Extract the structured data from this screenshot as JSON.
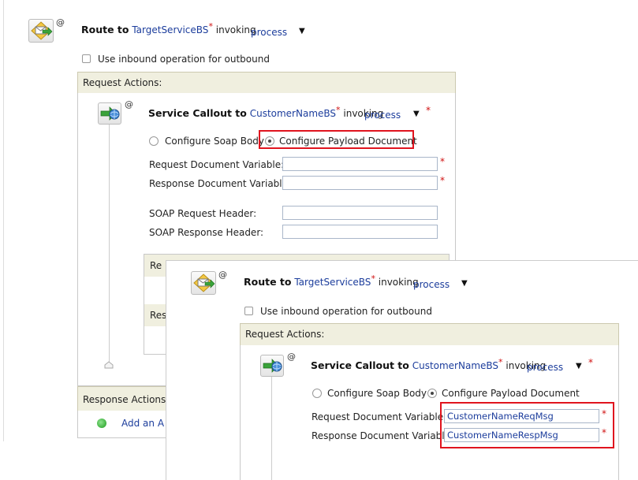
{
  "back": {
    "route": {
      "prefix": "Route to",
      "service": "TargetServiceBS",
      "star": "*",
      "invoking": "invoking",
      "operation": "process",
      "caret": "▼",
      "at": "@"
    },
    "inbound_checkbox_label": "Use inbound operation for outbound",
    "request_actions_label": "Request Actions:",
    "callout": {
      "prefix": "Service Callout to",
      "service": "CustomerNameBS",
      "star": "*",
      "invoking": "invoking",
      "operation": "process",
      "caret": "▼",
      "required": "*",
      "at": "@"
    },
    "radio_soap_body": "Configure Soap Body",
    "radio_payload": "Configure Payload Document",
    "request_doc_label": "Request Document Variable:",
    "response_doc_label": "Response Document Variable:",
    "soap_req_header_label": "SOAP Request Header:",
    "soap_resp_header_label": "SOAP Response Header:",
    "required_star": "*",
    "partial_re": "Re",
    "partial_res": "Res",
    "response_actions_label": "Response Actions:",
    "add_an_label": "Add an A"
  },
  "front": {
    "route": {
      "prefix": "Route to",
      "service": "TargetServiceBS",
      "star": "*",
      "invoking": "invoking",
      "operation": "process",
      "caret": "▼",
      "at": "@"
    },
    "inbound_checkbox_label": "Use inbound operation for outbound",
    "request_actions_label": "Request Actions:",
    "callout": {
      "prefix": "Service Callout to",
      "service": "CustomerNameBS",
      "star": "*",
      "invoking": "invoking",
      "operation": "process",
      "caret": "▼",
      "required": "*",
      "at": "@"
    },
    "radio_soap_body": "Configure Soap Body",
    "radio_payload": "Configure Payload Document",
    "request_doc_label": "Request Document Variable:",
    "response_doc_label": "Response Document Variable:",
    "request_doc_value": "CustomerNameReqMsg",
    "response_doc_value": "CustomerNameRespMsg",
    "required_star": "*"
  },
  "colors": {
    "highlight": "#e0141e",
    "link": "#1c3d9c",
    "header_bg": "#f0efdf"
  },
  "icons": {
    "route": "route-node-icon",
    "callout": "service-callout-icon",
    "add": "add-action-icon"
  }
}
